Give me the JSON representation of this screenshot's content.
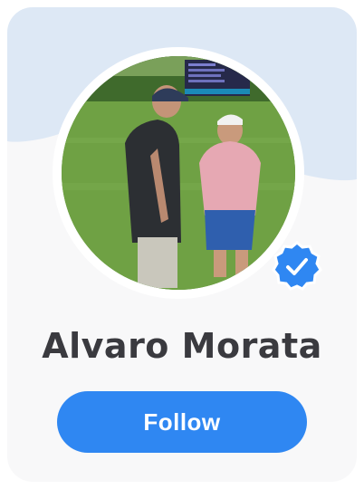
{
  "profile": {
    "name": "Alvaro Morata",
    "verified": true,
    "avatar": "avatar-photo-golf-course"
  },
  "actions": {
    "follow_label": "Follow"
  },
  "colors": {
    "accent": "#2f87f2",
    "banner": "#dde8f5",
    "card": "#f8f8f9",
    "name_text": "#3a3a3f",
    "badge": "#2f87f2"
  },
  "icons": {
    "verified": "check-badge-icon"
  }
}
